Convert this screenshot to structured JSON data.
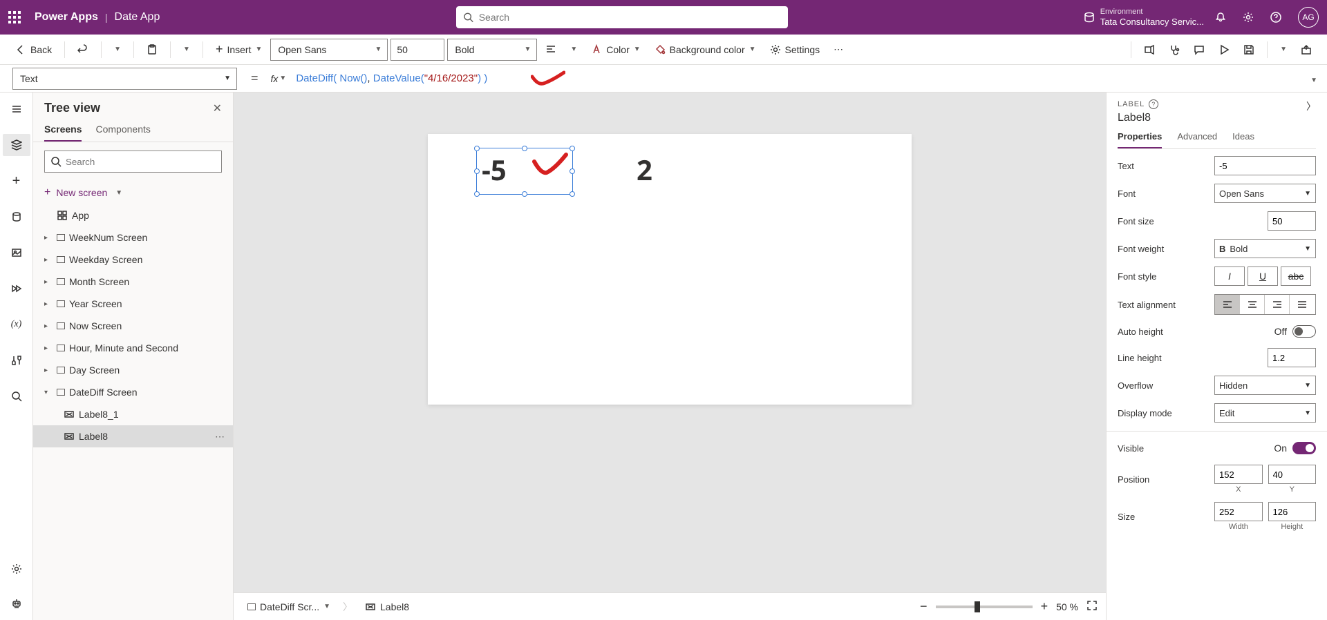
{
  "header": {
    "brand": "Power Apps",
    "app_name": "Date App",
    "search_placeholder": "Search",
    "env_label": "Environment",
    "env_name": "Tata Consultancy Servic...",
    "avatar": "AG"
  },
  "cmdbar": {
    "back": "Back",
    "insert": "Insert",
    "font": "Open Sans",
    "font_size": "50",
    "font_weight": "Bold",
    "color": "Color",
    "bg_color": "Background color",
    "settings": "Settings"
  },
  "fxbar": {
    "property": "Text",
    "formula_fn1": "DateDiff",
    "formula_fn2": "Now",
    "formula_fn3": "DateValue",
    "formula_str": "\"4/16/2023\""
  },
  "tree": {
    "title": "Tree view",
    "tabs": {
      "screens": "Screens",
      "components": "Components"
    },
    "search_placeholder": "Search",
    "new_screen": "New screen",
    "app": "App",
    "items": [
      "WeekNum Screen",
      "Weekday Screen",
      "Month Screen",
      "Year Screen",
      "Now Screen",
      "Hour, Minute and Second",
      "Day Screen",
      "DateDiff Screen"
    ],
    "children": [
      "Label8_1",
      "Label8"
    ]
  },
  "canvas": {
    "label1_text": "-5",
    "label2_text": "2",
    "breadcrumb_screen": "DateDiff Scr...",
    "breadcrumb_ctrl": "Label8",
    "zoom": "50",
    "zoom_unit": "%"
  },
  "props": {
    "type": "LABEL",
    "name": "Label8",
    "tabs": {
      "properties": "Properties",
      "advanced": "Advanced",
      "ideas": "Ideas"
    },
    "rows": {
      "text": {
        "label": "Text",
        "value": "-5"
      },
      "font": {
        "label": "Font",
        "value": "Open Sans"
      },
      "font_size": {
        "label": "Font size",
        "value": "50"
      },
      "font_weight": {
        "label": "Font weight",
        "value": "Bold"
      },
      "font_style": {
        "label": "Font style"
      },
      "text_align": {
        "label": "Text alignment"
      },
      "auto_height": {
        "label": "Auto height",
        "value": "Off"
      },
      "line_height": {
        "label": "Line height",
        "value": "1.2"
      },
      "overflow": {
        "label": "Overflow",
        "value": "Hidden"
      },
      "display_mode": {
        "label": "Display mode",
        "value": "Edit"
      },
      "visible": {
        "label": "Visible",
        "value": "On"
      },
      "position": {
        "label": "Position",
        "x": "152",
        "y": "40",
        "xl": "X",
        "yl": "Y"
      },
      "size": {
        "label": "Size",
        "w": "252",
        "h": "126",
        "wl": "Width",
        "hl": "Height"
      }
    }
  }
}
